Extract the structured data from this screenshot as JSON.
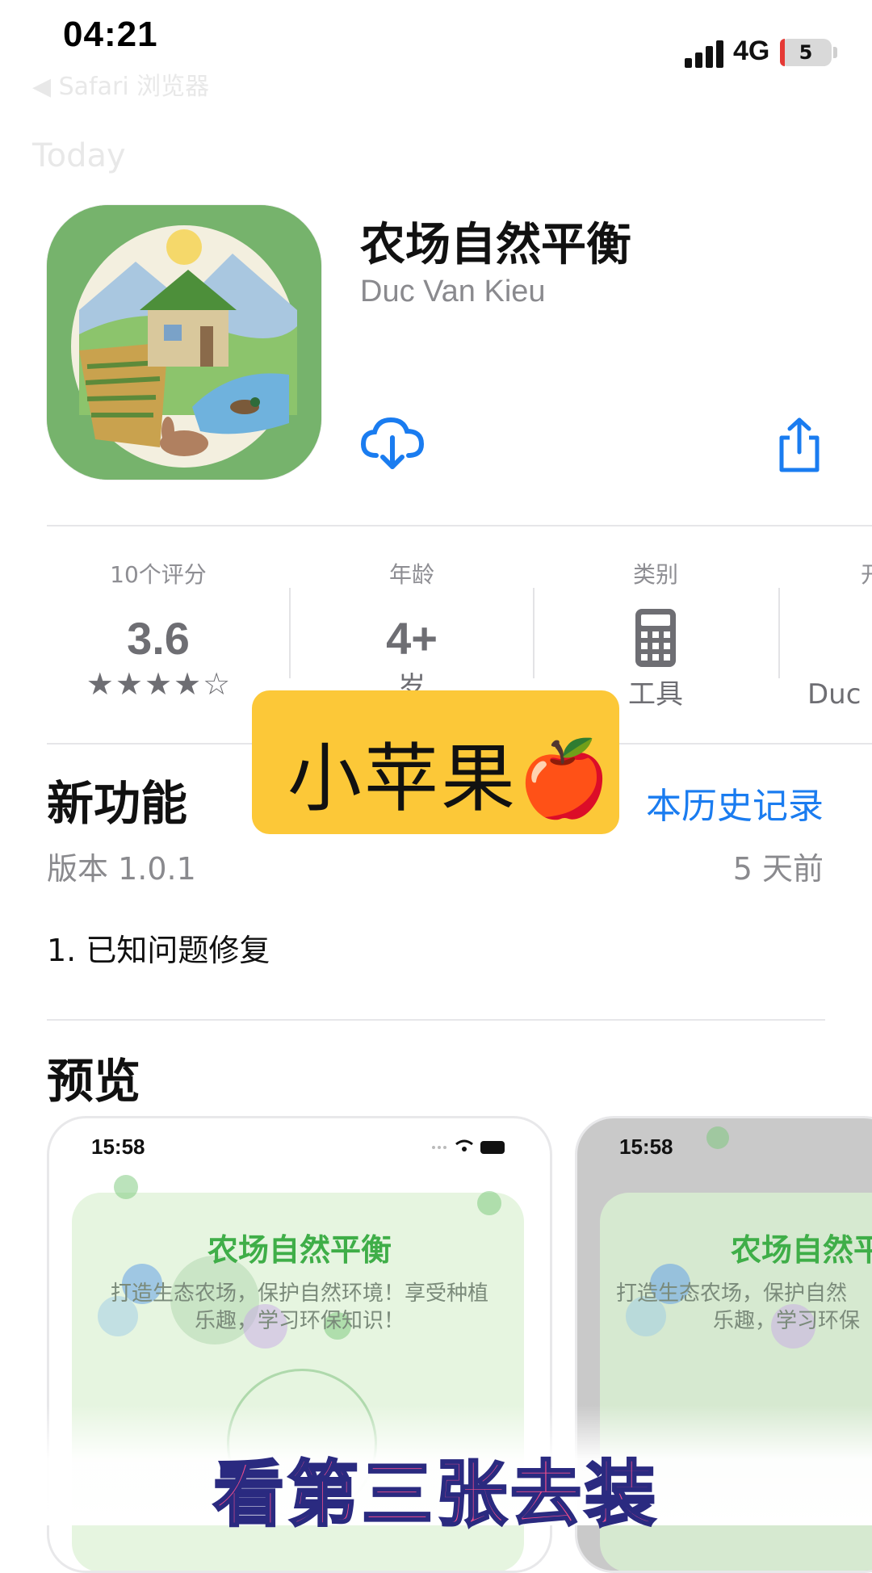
{
  "status_bar": {
    "time": "04:21",
    "network": "4G",
    "battery": "5",
    "back_hint": "◀ Safari 浏览器",
    "back_label": "Today"
  },
  "app": {
    "name": "农场自然平衡",
    "developer": "Duc Van Kieu",
    "download_icon": "cloud-download-icon",
    "share_icon": "share-icon"
  },
  "info": {
    "ratings": {
      "label": "10个评分",
      "value": "3.6",
      "stars": 3.6,
      "max_stars": 5
    },
    "age": {
      "label": "年龄",
      "value": "4+",
      "unit": "岁"
    },
    "category": {
      "label": "类别",
      "value": "工具",
      "icon": "calculator-icon"
    },
    "developer": {
      "label": "开",
      "value": "Duc"
    }
  },
  "whats_new": {
    "heading": "新功能",
    "history_link": "本历史记录",
    "version": "版本 1.0.1",
    "date": "5 天前",
    "notes": "1. 已知问题修复"
  },
  "preview": {
    "heading": "预览",
    "screens": [
      {
        "time": "15:58",
        "title": "农场自然平衡",
        "subtitle_line1": "打造生态农场，保护自然环境！享受种植",
        "subtitle_line2": "乐趣，学习环保知识！"
      },
      {
        "time": "15:58",
        "title": "农场自然平",
        "subtitle_line1": "打造生态农场，保护自然",
        "subtitle_line2": "乐趣，学习环保"
      }
    ]
  },
  "overlay": {
    "sticker": "小苹果🍎",
    "caption": "看第三张去装"
  },
  "colors": {
    "accent": "#1a7cf0",
    "sticker_bg": "#fcc838",
    "caption": "#f04d8c",
    "preview_green": "#3fae48"
  }
}
